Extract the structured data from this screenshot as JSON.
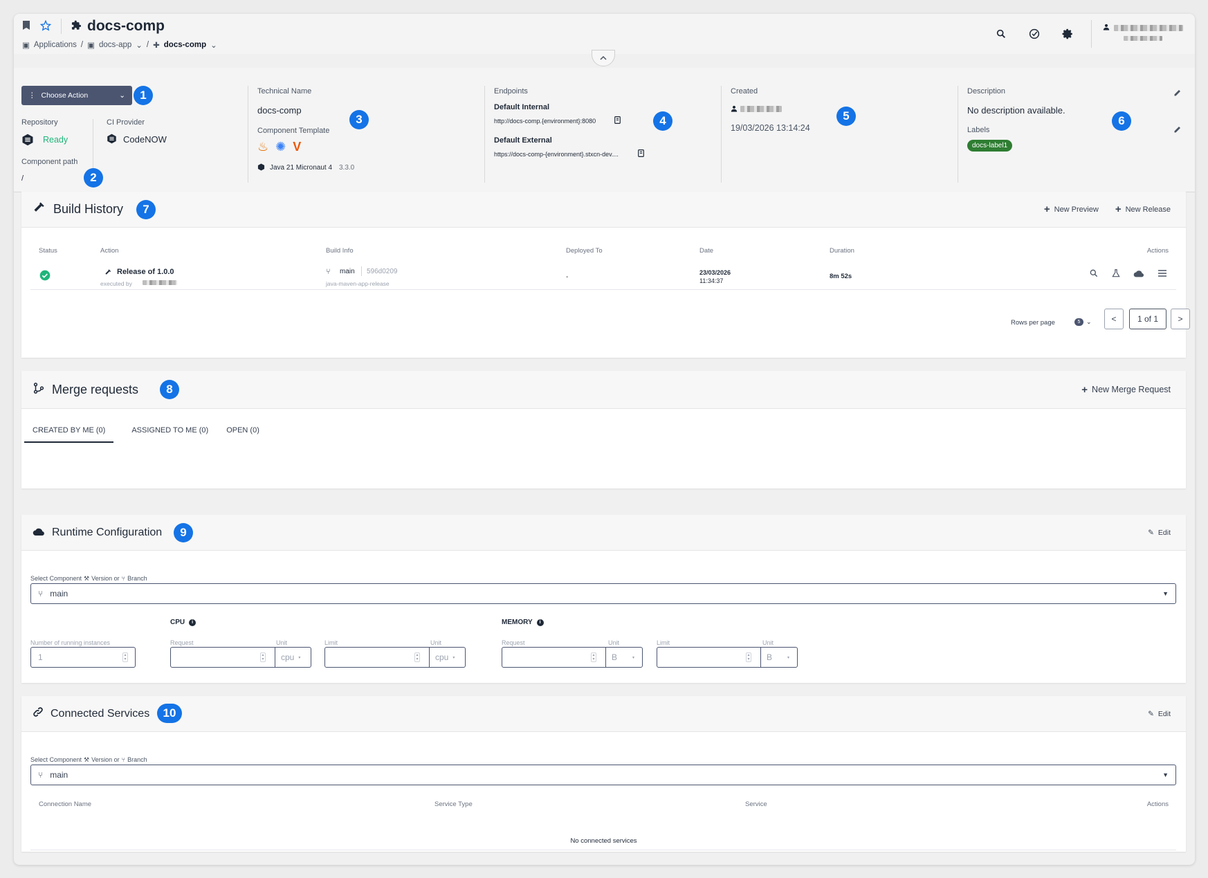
{
  "header": {
    "title": "docs-comp",
    "breadcrumb": [
      "Applications",
      "docs-app",
      "docs-comp"
    ]
  },
  "info": {
    "choose_action": "Choose Action",
    "repository_label": "Repository",
    "repository_status": "Ready",
    "ci_label": "CI Provider",
    "ci_value": "CodeNOW",
    "component_path_label": "Component path",
    "component_path": "/",
    "technical_name_label": "Technical Name",
    "technical_name": "docs-comp",
    "template_label": "Component Template",
    "template_name": "Java 21 Micronaut 4",
    "template_version": "3.3.0",
    "endpoints_label": "Endpoints",
    "internal_label": "Default Internal",
    "internal_url": "http://docs-comp.{environment}:8080",
    "external_label": "Default External",
    "external_url": "https://docs-comp-{environment}.stxcn-dev....",
    "created_label": "Created",
    "created_date": "19/03/2026 13:14:24",
    "description_label": "Description",
    "description": "No description available.",
    "labels_label": "Labels",
    "labels": [
      "docs-label1"
    ]
  },
  "badges": [
    "1",
    "2",
    "3",
    "4",
    "5",
    "6",
    "7",
    "8",
    "9",
    "10"
  ],
  "build_history": {
    "title": "Build History",
    "new_preview": "New Preview",
    "new_release": "New Release",
    "columns": [
      "Status",
      "Action",
      "Build Info",
      "Deployed To",
      "Date",
      "Duration",
      "Actions"
    ],
    "row": {
      "action": "Release of 1.0.0",
      "executed_by": "executed by",
      "branch": "main",
      "commit": "596d0209",
      "pipeline": "java-maven-app-release",
      "deployed_to": "-",
      "date": "23/03/2026",
      "time": "11:34:37",
      "duration": "8m 52s"
    },
    "rows_per_page": "Rows per page",
    "rows_per_page_value": "5",
    "page": "1 of 1"
  },
  "merge_requests": {
    "title": "Merge requests",
    "new_mr": "New Merge Request",
    "tabs": [
      "CREATED BY ME (0)",
      "ASSIGNED TO ME (0)",
      "OPEN (0)"
    ]
  },
  "runtime": {
    "title": "Runtime Configuration",
    "edit": "Edit",
    "select_label": "Select Component",
    "select_version": "Version or",
    "select_branch": "Branch",
    "selected": "main",
    "instances_label": "Number of running instances",
    "instances_value": "1",
    "cpu": "CPU",
    "memory": "MEMORY",
    "request": "Request",
    "limit": "Limit",
    "unit": "Unit",
    "cpu_unit": "cpu",
    "mem_unit": "B"
  },
  "connected": {
    "title": "Connected Services",
    "edit": "Edit",
    "select_label": "Select Component",
    "select_version": "Version or",
    "select_branch": "Branch",
    "selected": "main",
    "columns": [
      "Connection Name",
      "Service Type",
      "Service",
      "Actions"
    ],
    "empty": "No connected services"
  }
}
